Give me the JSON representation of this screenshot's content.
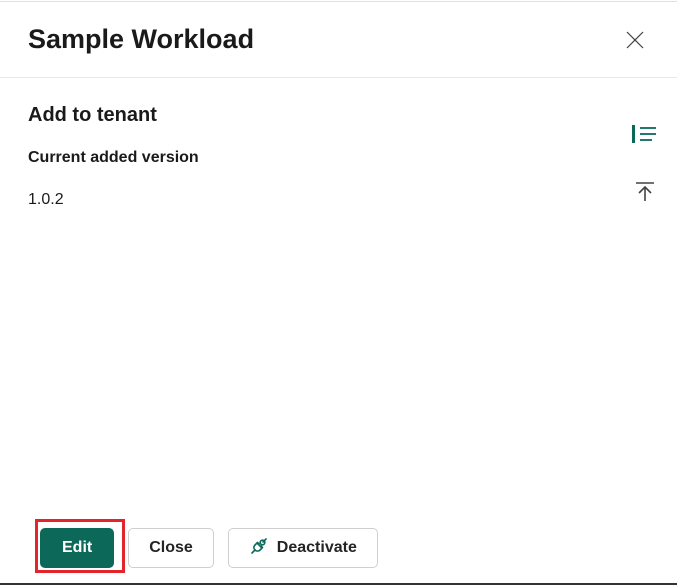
{
  "header": {
    "title": "Sample Workload"
  },
  "section": {
    "title": "Add to tenant",
    "field_label": "Current added version",
    "field_value": "1.0.2"
  },
  "footer": {
    "edit_label": "Edit",
    "close_label": "Close",
    "deactivate_label": "Deactivate"
  },
  "colors": {
    "primary": "#0c695a",
    "highlight": "#e3242b"
  }
}
